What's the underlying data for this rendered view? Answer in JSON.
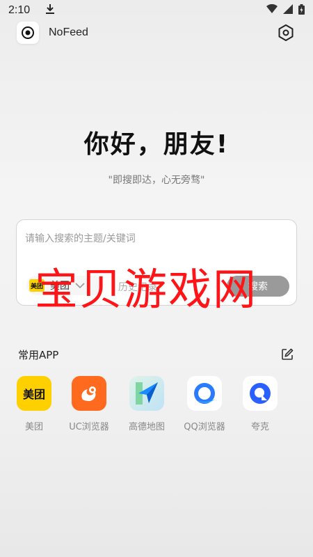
{
  "status_bar": {
    "time": "2:10",
    "download_icon": "download-icon",
    "wifi_icon": "wifi-icon",
    "signal_icon": "signal-icon",
    "battery_icon": "battery-icon"
  },
  "header": {
    "app_name": "NoFeed",
    "logo_icon": "target-icon",
    "settings_icon": "hexagon-settings-icon"
  },
  "greeting": "你好，朋友!",
  "slogan": "\"即搜即达，心无旁骛\"",
  "search": {
    "placeholder": "请输入搜索的主题/关键词",
    "engine_logo_text": "美团",
    "engine_name": "美团",
    "history_label": "历史记录",
    "search_button": "搜索"
  },
  "watermark": "宝贝游戏网",
  "apps_section": {
    "title": "常用APP",
    "edit_icon": "edit-icon",
    "apps": [
      {
        "label": "美团",
        "icon": "meituan-icon",
        "icon_text": "美团",
        "color": "#FFD000"
      },
      {
        "label": "UC浏览器",
        "icon": "uc-browser-icon",
        "color": "#FF6A1F"
      },
      {
        "label": "高德地图",
        "icon": "amap-icon",
        "color": "#1A8CFF"
      },
      {
        "label": "QQ浏览器",
        "icon": "qq-browser-icon",
        "color": "#2B7BFF"
      },
      {
        "label": "夸克",
        "icon": "quark-icon",
        "color": "#2A60FF"
      }
    ]
  }
}
